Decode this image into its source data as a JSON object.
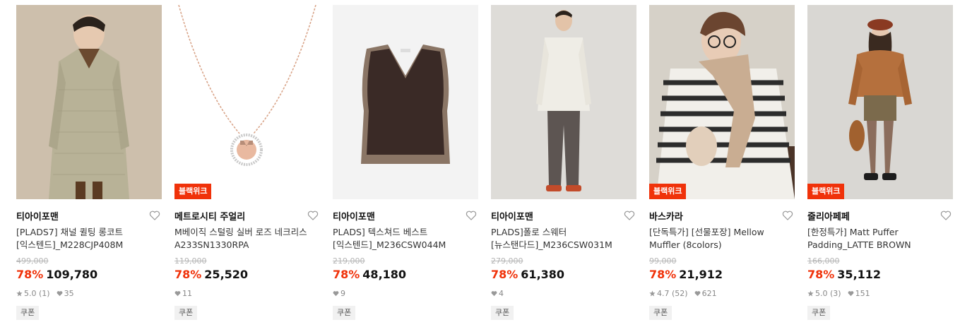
{
  "products": [
    {
      "brand": "티아이포맨",
      "name_line1": "[PLADS7] 채널 퀼팅 롱코트",
      "name_line2": "[익스텐드]_M228CJP408M",
      "original_price": "499,000",
      "discount": "78%",
      "price": "109,780",
      "rating": "5.0",
      "review_count": "(1)",
      "likes": "35",
      "badge": "",
      "coupon": "쿠폰"
    },
    {
      "brand": "메트로시티 주얼리",
      "name_line1": "M베이직 스털링 실버 로즈 네크리스",
      "name_line2": "A233SN1330RPA",
      "original_price": "119,000",
      "discount": "78%",
      "price": "25,520",
      "rating": "",
      "review_count": "",
      "likes": "11",
      "badge": "블랙위크",
      "coupon": "쿠폰"
    },
    {
      "brand": "티아이포맨",
      "name_line1": "PLADS] 텍스쳐드 베스트",
      "name_line2": "[익스텐드]_M236CSW044M",
      "original_price": "219,000",
      "discount": "78%",
      "price": "48,180",
      "rating": "",
      "review_count": "",
      "likes": "9",
      "badge": "",
      "coupon": "쿠폰"
    },
    {
      "brand": "티아이포맨",
      "name_line1": "PLADS]폴로 스웨터",
      "name_line2": "[뉴스탠다드]_M236CSW031M",
      "original_price": "279,000",
      "discount": "78%",
      "price": "61,380",
      "rating": "",
      "review_count": "",
      "likes": "4",
      "badge": "",
      "coupon": "쿠폰"
    },
    {
      "brand": "바스카라",
      "name_line1": "[단독특가] [선물포장] Mellow",
      "name_line2": "Muffler (8colors)",
      "original_price": "99,000",
      "discount": "78%",
      "price": "21,912",
      "rating": "4.7",
      "review_count": "(52)",
      "likes": "621",
      "badge": "블랙위크",
      "coupon": "쿠폰"
    },
    {
      "brand": "줄리아페페",
      "name_line1": "[한정특가] Matt Puffer",
      "name_line2": "Padding_LATTE BROWN",
      "original_price": "166,000",
      "discount": "78%",
      "price": "35,112",
      "rating": "5.0",
      "review_count": "(3)",
      "likes": "151",
      "badge": "블랙위크",
      "coupon": "쿠폰"
    }
  ],
  "colors": {
    "accent": "#f0320a",
    "strike": "#b5b5b5",
    "meta": "#888888"
  },
  "icons": {
    "wish": "heart-outline-icon",
    "rating": "star-icon",
    "likes": "heart-filled-icon"
  }
}
